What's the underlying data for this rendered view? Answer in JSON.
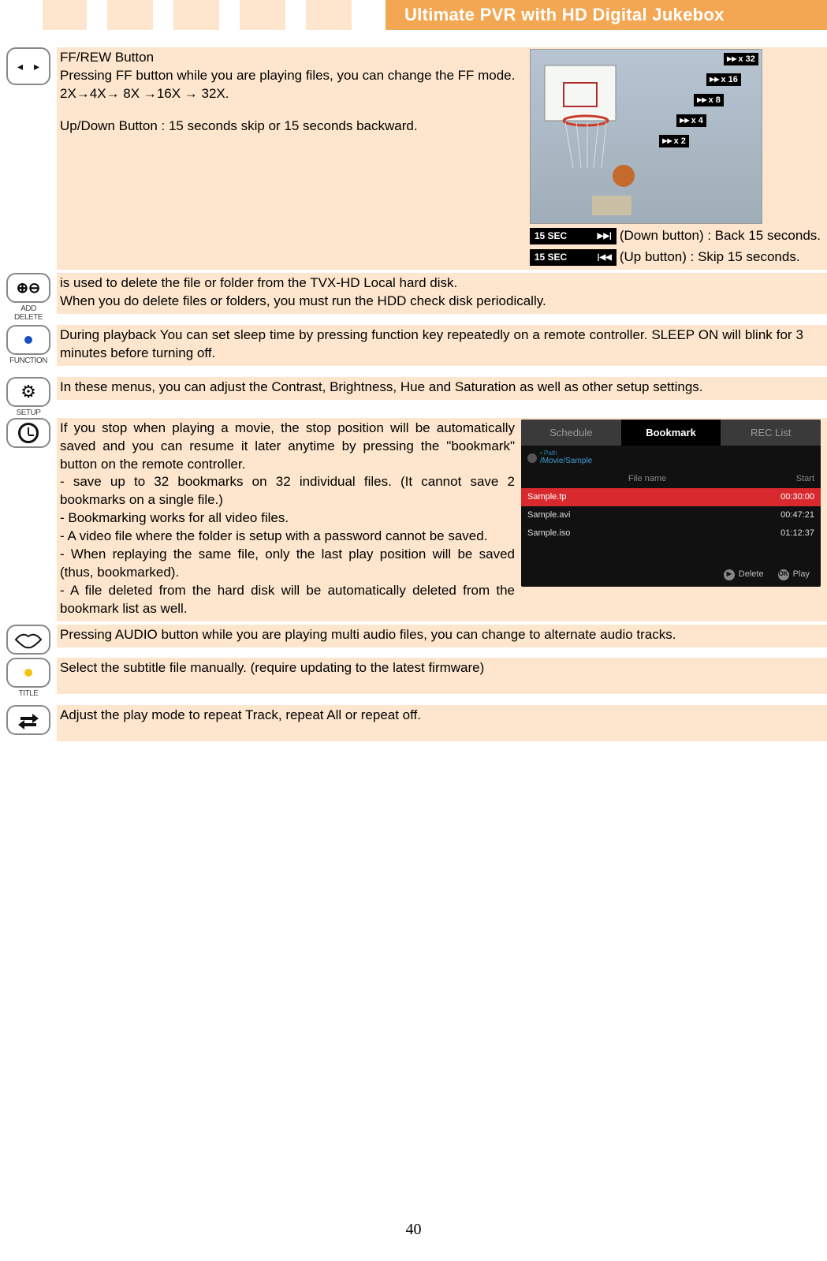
{
  "page_number": "40",
  "title": "Ultimate PVR with HD Digital Jukebox",
  "ffrew": {
    "heading": "FF/REW Button",
    "line1": "Pressing FF button while you are playing files, you can change the FF mode.",
    "line2": "2X→4X→ 8X →16X → 32X.",
    "updown": "Up/Down Button : 15 seconds skip or 15 seconds backward.",
    "sec15": "15 SEC",
    "down_label": "(Down button) : Back 15 seconds.",
    "up_label": " (Up button) : Skip 15 seconds.",
    "speeds": [
      "x 32",
      "x 16",
      "x 8",
      "x 4",
      "x 2"
    ]
  },
  "add_delete": {
    "line1": "is used to delete the file or folder from the TVX-HD Local hard disk.",
    "line2": "When you do delete files or folders, you must run the HDD check disk periodically.",
    "icon_label": "ADD DELETE"
  },
  "function_btn": {
    "text": "During playback You can set sleep time by pressing function key repeatedly on a remote controller. SLEEP ON will blink for 3 minutes before turning off.",
    "icon_label": "FUNCTION"
  },
  "setup_btn": {
    "text": "In these menus, you can adjust the Contrast, Brightness, Hue and Saturation as well as other setup settings.",
    "icon_label": "SETUP"
  },
  "bookmark": {
    "p1": "If you stop when playing a movie, the stop position will be automatically saved and you can resume it later anytime by pressing the \"bookmark\" button on the remote controller.",
    "b1": "- save up to 32 bookmarks on 32 individual files. (It cannot save 2 bookmarks on a single file.)",
    "b2": "- Bookmarking works for all video files.",
    "b3": "- A video file where the folder is setup with a password cannot be saved.",
    "b4": "- When replaying the same file, only the last play position will be saved (thus, bookmarked).",
    "b5": "- A file deleted from the hard disk will be automatically deleted from the bookmark list as well.",
    "ui": {
      "tab_schedule": "Schedule",
      "tab_bookmark": "Bookmark",
      "tab_reclist": "REC List",
      "path": "/Movie/Sample",
      "path_label": "Path",
      "col_file": "File name",
      "col_start": "Start",
      "rows": [
        {
          "file": "Sample.tp",
          "start": "00:30:00"
        },
        {
          "file": "Sample.avi",
          "start": "00:47:21"
        },
        {
          "file": "Sample.iso",
          "start": "01:12:37"
        }
      ],
      "delete_label": "Delete",
      "delete_key": "▶❙❙",
      "play_label": "Play",
      "play_key": "OK"
    }
  },
  "audio": {
    "text": "Pressing AUDIO button while you are playing multi audio files, you can change to alternate audio tracks."
  },
  "title_btn": {
    "text": "Select the subtitle file manually. (require updating to the latest firmware)",
    "icon_label": "TITLE"
  },
  "repeat": {
    "text": "Adjust the play mode to repeat Track, repeat All or repeat off."
  }
}
